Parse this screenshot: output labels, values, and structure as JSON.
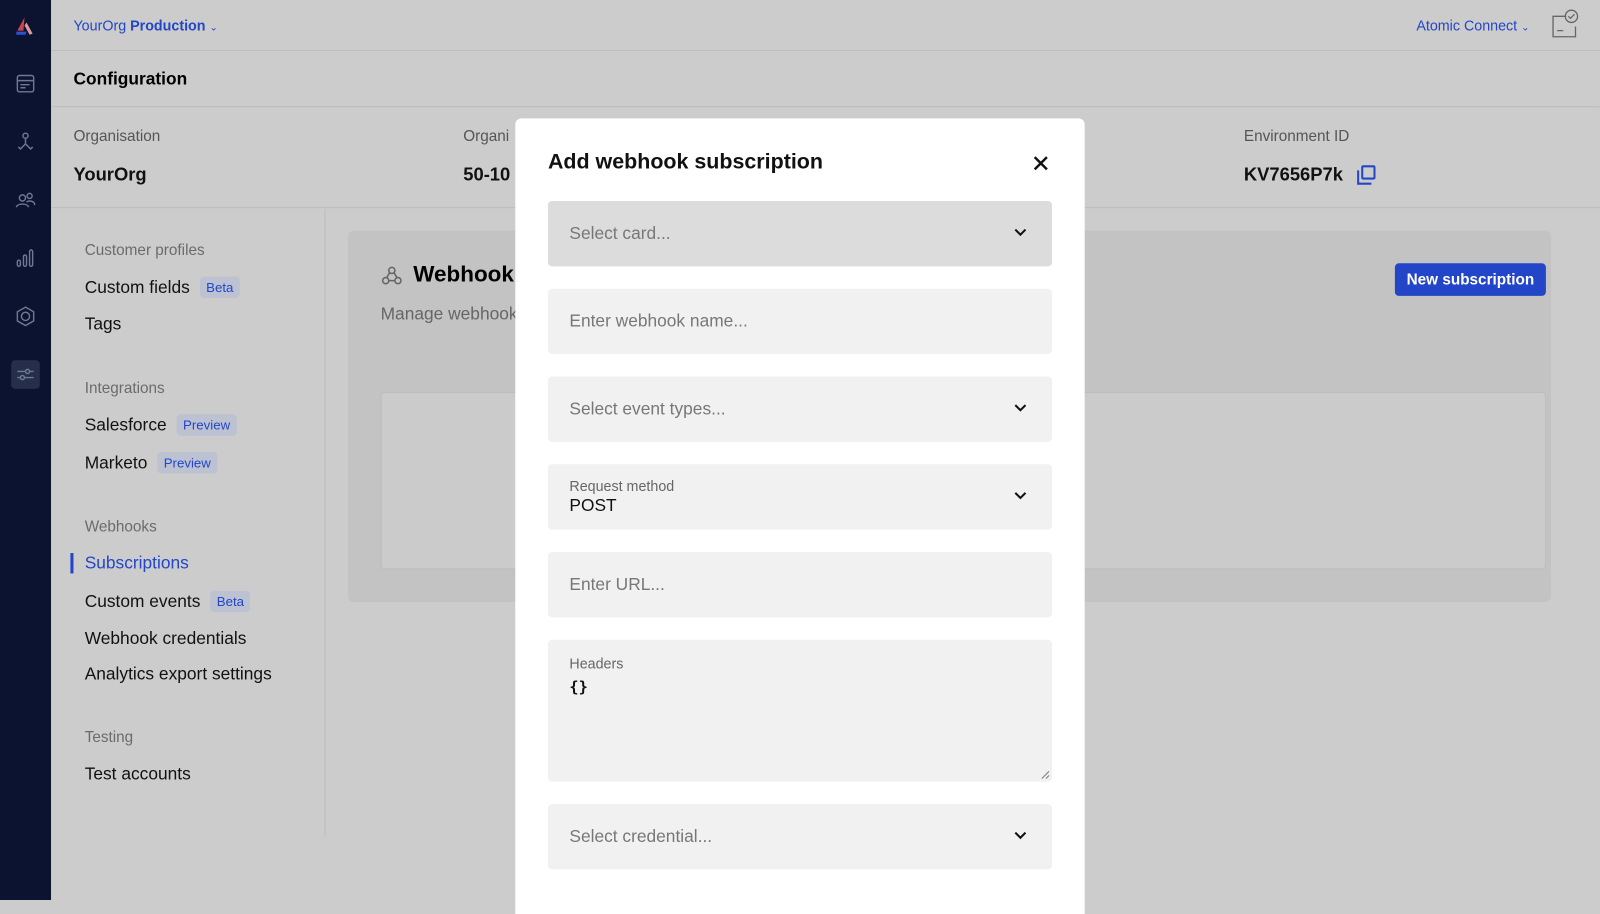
{
  "topbar": {
    "org": "YourOrg",
    "environment": "Production",
    "app": "Atomic Connect"
  },
  "rail": {
    "icons": [
      "atomic-logo",
      "cards-icon",
      "workflows-icon",
      "customers-icon",
      "analytics-icon",
      "integrations-icon",
      "configuration-icon"
    ]
  },
  "page": {
    "title": "Configuration"
  },
  "info": [
    {
      "label": "Organisation",
      "value": "YourOrg"
    },
    {
      "label": "Organi",
      "value": "50-10"
    },
    {
      "label": "Environment ID",
      "value": "KV7656P7k"
    }
  ],
  "nav": {
    "sections": [
      {
        "title": "Customer profiles",
        "items": [
          {
            "label": "Custom fields",
            "badge": "Beta"
          },
          {
            "label": "Tags"
          }
        ]
      },
      {
        "title": "Integrations",
        "items": [
          {
            "label": "Salesforce",
            "badge": "Preview"
          },
          {
            "label": "Marketo",
            "badge": "Preview"
          }
        ]
      },
      {
        "title": "Webhooks",
        "items": [
          {
            "label": "Subscriptions",
            "active": true
          },
          {
            "label": "Custom events",
            "badge": "Beta"
          },
          {
            "label": "Webhook credentials"
          },
          {
            "label": "Analytics export settings"
          }
        ]
      },
      {
        "title": "Testing",
        "items": [
          {
            "label": "Test accounts"
          }
        ]
      }
    ]
  },
  "content": {
    "title": "Webhook",
    "subtitle": "Manage webhook",
    "new_button": "New subscription"
  },
  "modal": {
    "title": "Add webhook subscription",
    "card_placeholder": "Select card...",
    "name_placeholder": "Enter webhook name...",
    "events_placeholder": "Select event types...",
    "method_label": "Request method",
    "method_value": "POST",
    "url_placeholder": "Enter URL...",
    "headers_label": "Headers",
    "headers_value": "{}",
    "credential_placeholder": "Select credential..."
  },
  "colors": {
    "accent": "#2346c8",
    "rail": "#0b1330"
  }
}
